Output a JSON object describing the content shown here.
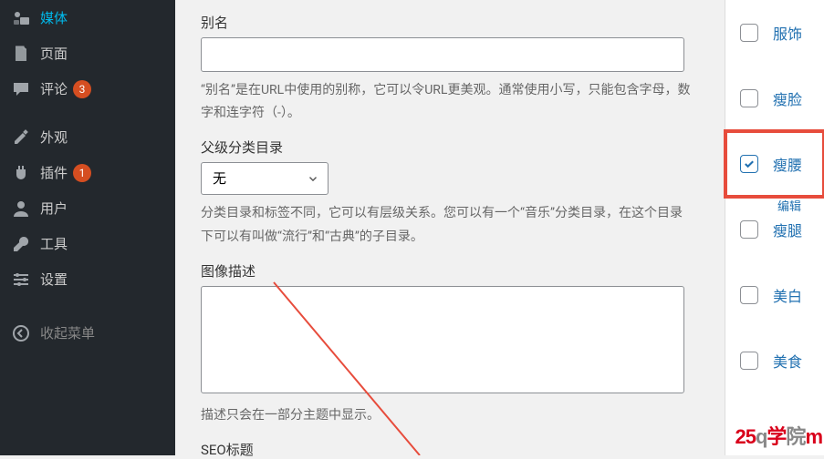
{
  "sidebar": {
    "items": [
      {
        "label": "媒体",
        "icon": "media"
      },
      {
        "label": "页面",
        "icon": "page"
      },
      {
        "label": "评论",
        "icon": "comment",
        "badge": "3"
      },
      {
        "label": "外观",
        "icon": "appearance"
      },
      {
        "label": "插件",
        "icon": "plugin",
        "badge": "1"
      },
      {
        "label": "用户",
        "icon": "user"
      },
      {
        "label": "工具",
        "icon": "tool"
      },
      {
        "label": "设置",
        "icon": "settings"
      }
    ],
    "collapse_label": "收起菜单"
  },
  "form": {
    "alias_label": "别名",
    "alias_value": "",
    "alias_help": "“别名”是在URL中使用的别称，它可以令URL更美观。通常使用小写，只能包含字母，数字和连字符（-）。",
    "parent_label": "父级分类目录",
    "parent_value": "无",
    "parent_help": "分类目录和标签不同，它可以有层级关系。您可以有一个“音乐”分类目录，在这个目录下可以有叫做“流行”和“古典”的子目录。",
    "img_desc_label": "图像描述",
    "img_desc_value": "",
    "img_desc_help": "描述只会在一部分主题中显示。",
    "seo_title_label": "SEO标题"
  },
  "categories": [
    {
      "label": "服饰",
      "checked": false
    },
    {
      "label": "瘦脸",
      "checked": false
    },
    {
      "label": "瘦腰",
      "checked": true,
      "highlight": true
    },
    {
      "label": "瘦腿",
      "checked": false
    },
    {
      "label": "美白",
      "checked": false
    },
    {
      "label": "美食",
      "checked": false
    }
  ],
  "edit_label": "编辑",
  "watermark": {
    "p1": "25",
    "p2": "q",
    "p3": "学",
    "p4": "院",
    "p5": "m"
  }
}
